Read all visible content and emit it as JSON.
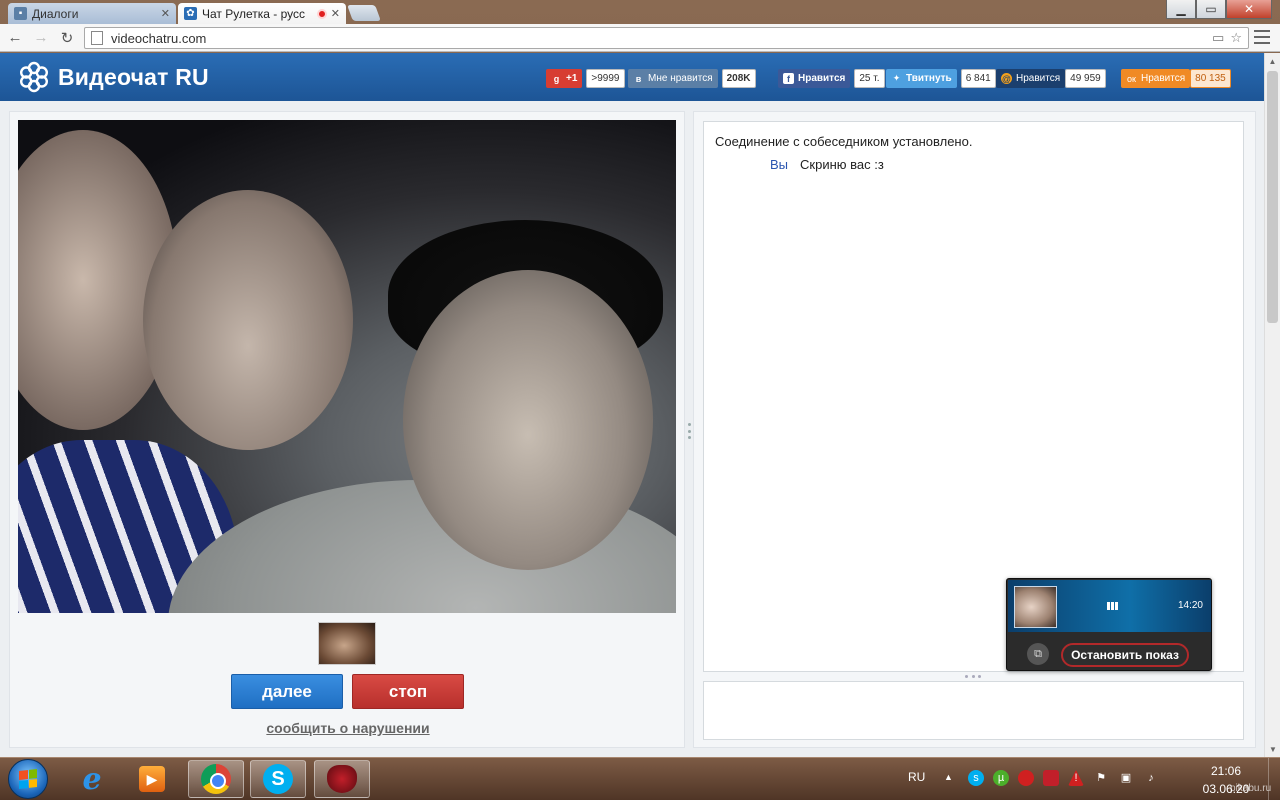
{
  "browser": {
    "tabs": [
      {
        "title": "Диалоги",
        "active": false
      },
      {
        "title": "Чат Рулетка - русс",
        "active": true
      }
    ],
    "url": "videochatru.com",
    "window_controls": {
      "minimize": "▁",
      "maximize": "▭",
      "close": "✕"
    }
  },
  "site": {
    "logo_text": "Видеочат RU",
    "social": {
      "gplus": {
        "label": "+1",
        "count": ">9999"
      },
      "vk": {
        "label": "Мне нравится",
        "count": "208K"
      },
      "fb": {
        "label": "Нравится",
        "count": "25 т."
      },
      "twitter": {
        "label": "Твитнуть",
        "count": "6 841"
      },
      "mail": {
        "label": "Нравится",
        "count": "49 959"
      },
      "ok": {
        "label": "Нравится",
        "count": "80 135"
      }
    },
    "colors": {
      "header": "#2a6db5",
      "next": "#2a7fd4",
      "stop": "#c23a35"
    }
  },
  "video_panel": {
    "next_button": "далее",
    "stop_button": "стоп",
    "report_link": "сообщить о нарушении"
  },
  "chat": {
    "system_message": "Соединение с собеседником установлено.",
    "messages": [
      {
        "author": "Вы",
        "text": "Скриню вас :з"
      }
    ]
  },
  "share_widget": {
    "time": "14:20",
    "stop_label": "Остановить показ"
  },
  "taskbar": {
    "language": "RU",
    "time": "21:06",
    "date": "03.06.20",
    "watermark": "pikabu.ru"
  }
}
